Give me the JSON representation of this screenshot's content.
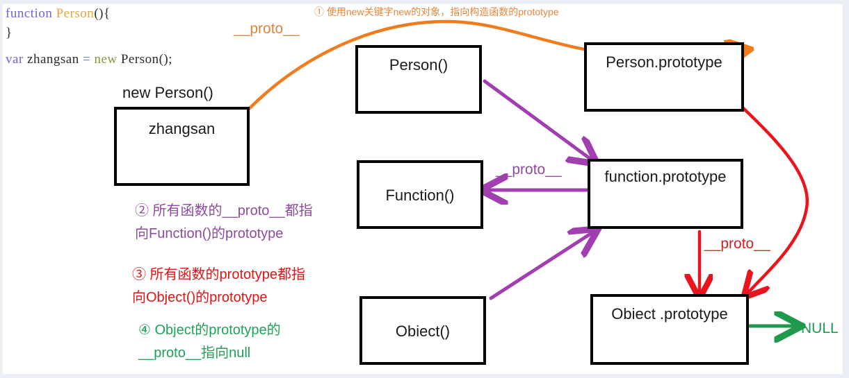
{
  "page": {
    "title": "JavaScript prototype chain diagram",
    "background_color": "#ffffff",
    "outer_color": "#eceef5"
  },
  "code": {
    "line1": {
      "keyword": "function",
      "name": "Person",
      "tail": "(){"
    },
    "line2": {
      "text": "}"
    },
    "line3": {
      "keyword": "var",
      "variable": " zhangsan ",
      "operator": "=",
      "new": " new ",
      "call": "Person();"
    }
  },
  "boxes": [
    {
      "id": "zhangsan",
      "label": "zhangsan",
      "caption": "new Person()"
    },
    {
      "id": "person",
      "label": "Person()"
    },
    {
      "id": "person-prototype",
      "label": "Person.prototype"
    },
    {
      "id": "function",
      "label": "Function()"
    },
    {
      "id": "function-prototype",
      "label": "function.prototype"
    },
    {
      "id": "object",
      "label": "Obiect()"
    },
    {
      "id": "object-prototype",
      "label": "Obiect .prototype"
    }
  ],
  "edge_labels": {
    "proto_orange": "__proto__",
    "proto_purple": "__proto__",
    "proto_red": "__proto__",
    "null_target": "NULL"
  },
  "notes": {
    "orange": "① 使用new关键字new的对象，指向构造函数的prototype",
    "purple": "② 所有函数的__proto__都指\n向Function()的prototype",
    "red": "③ 所有函数的prototype都指\n向Object()的prototype",
    "green": "④ Object的prototype的\n__proto__指向null"
  },
  "colors": {
    "orange": "#f07c1f",
    "purple": "#a23fb0",
    "red": "#e8151f",
    "green": "#1f9a4d",
    "box_border": "#000000",
    "code_keyword": "#6f64d6",
    "code_function_name": "#e8a33d",
    "code_new": "#8c9440"
  }
}
